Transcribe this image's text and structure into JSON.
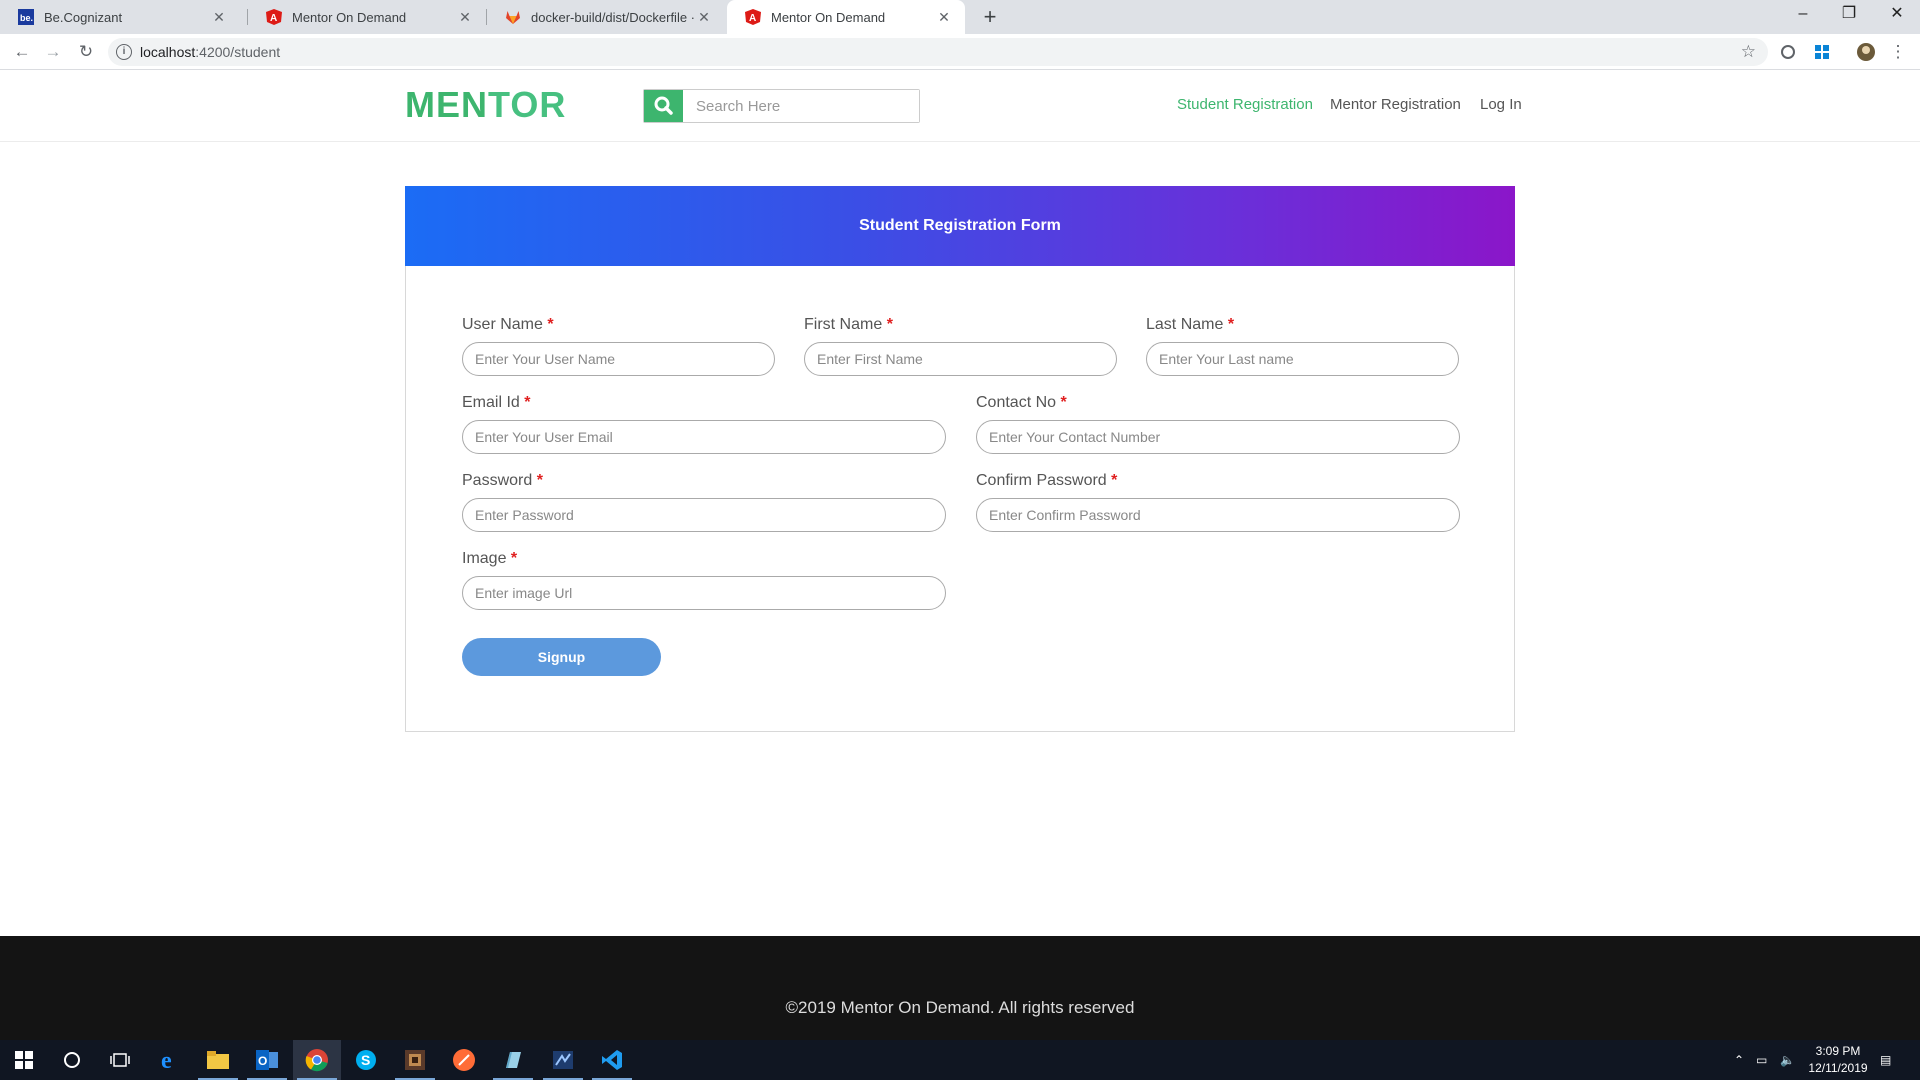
{
  "browser": {
    "tabs": [
      {
        "title": "Be.Cognizant"
      },
      {
        "title": "Mentor On Demand"
      },
      {
        "title": "docker-build/dist/Dockerfile · ma"
      },
      {
        "title": "Mentor On Demand"
      }
    ],
    "new_tab_symbol": "+",
    "address": {
      "host": "localhost",
      "path": ":4200/student"
    },
    "colors": {
      "tabstrip": "#dee1e6",
      "toolbar": "#ffffff"
    }
  },
  "header": {
    "logo_a": "MEN",
    "logo_b": "TOR",
    "search_placeholder": "Search Here",
    "nav": [
      {
        "label": "Student Registration",
        "active": true
      },
      {
        "label": "Mentor Registration",
        "active": false
      },
      {
        "label": "Log In",
        "active": false
      }
    ]
  },
  "form": {
    "title": "Student Registration Form",
    "required_mark": "*",
    "fields": {
      "user_name": {
        "label": "User Name",
        "placeholder": "Enter Your User Name"
      },
      "first_name": {
        "label": "First Name",
        "placeholder": "Enter First Name"
      },
      "last_name": {
        "label": "Last Name",
        "placeholder": "Enter Your Last name"
      },
      "email": {
        "label": "Email Id",
        "placeholder": "Enter Your User Email"
      },
      "contact": {
        "label": "Contact No",
        "placeholder": "Enter Your Contact Number"
      },
      "password": {
        "label": "Password",
        "placeholder": "Enter Password"
      },
      "confirm_password": {
        "label": "Confirm Password",
        "placeholder": "Enter Confirm Password"
      },
      "image": {
        "label": "Image",
        "placeholder": "Enter image Url"
      }
    },
    "submit_label": "Signup"
  },
  "footer": {
    "text": "©2019 Mentor On Demand. All rights reserved"
  },
  "taskbar": {
    "time": "3:09 PM",
    "date": "12/11/2019"
  },
  "colors": {
    "brand_green": "#3db56e",
    "header_gradient_start": "#1b6cf5",
    "header_gradient_end": "#8b16c9",
    "button_blue": "#5c99dd",
    "footer_bg": "#141414",
    "required_red": "#e02020"
  }
}
